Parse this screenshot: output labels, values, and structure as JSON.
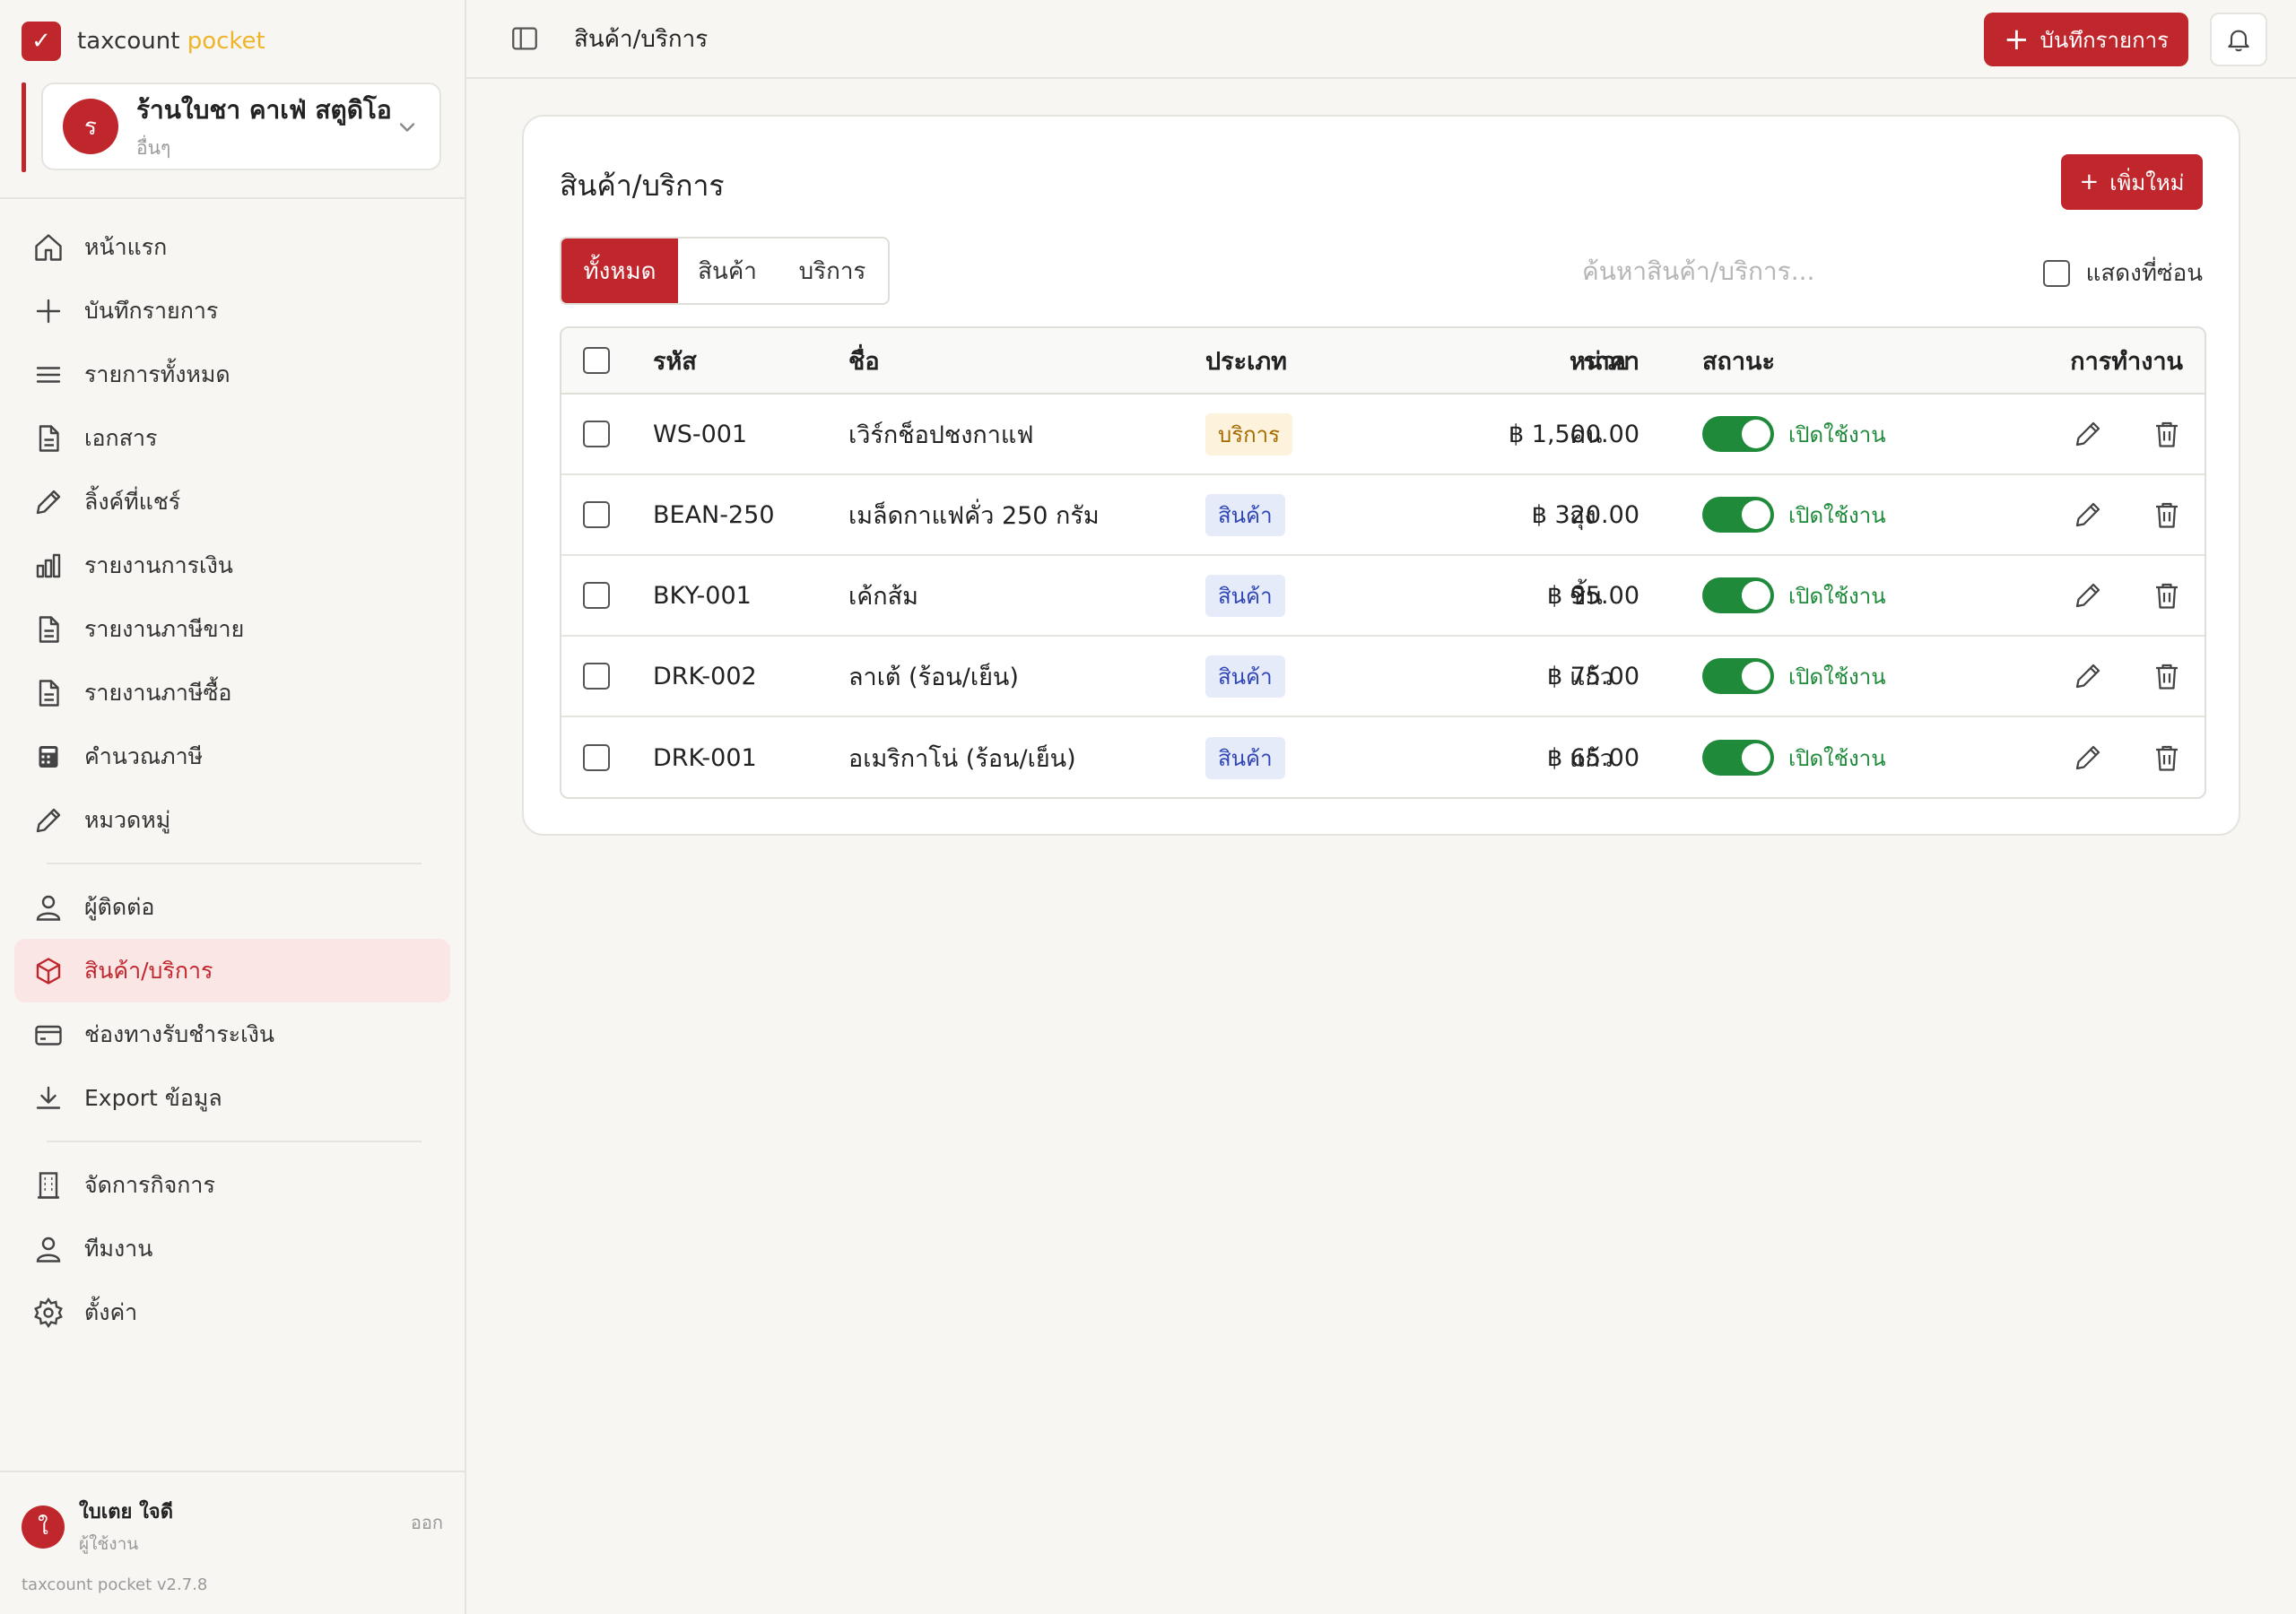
{
  "brand": {
    "name": "taxcount",
    "accent": "pocket",
    "logo_icon": "check-icon"
  },
  "business": {
    "initial": "ร",
    "name": "ร้านใบชา คาเฟ่ สตูดิโอ",
    "type": "อื่นๆ"
  },
  "nav": {
    "items": [
      {
        "label": "หน้าแรก",
        "icon": "home-icon"
      },
      {
        "label": "บันทึกรายการ",
        "icon": "plus-icon"
      },
      {
        "label": "รายการทั้งหมด",
        "icon": "list-icon"
      },
      {
        "label": "เอกสาร",
        "icon": "document-icon"
      },
      {
        "label": "ลิ้งค์ที่แชร์",
        "icon": "pencil-icon"
      },
      {
        "label": "รายงานการเงิน",
        "icon": "bar-chart-icon"
      },
      {
        "label": "รายงานภาษีขาย",
        "icon": "document-icon"
      },
      {
        "label": "รายงานภาษีซื้อ",
        "icon": "document-icon"
      },
      {
        "label": "คำนวณภาษี",
        "icon": "calculator-icon"
      },
      {
        "label": "หมวดหมู่",
        "icon": "pencil-icon"
      }
    ],
    "group2": [
      {
        "label": "ผู้ติดต่อ",
        "icon": "user-icon"
      },
      {
        "label": "สินค้า/บริการ",
        "icon": "box-icon",
        "active": true
      },
      {
        "label": "ช่องทางรับชำระเงิน",
        "icon": "credit-card-icon"
      },
      {
        "label": "Export ข้อมูล",
        "icon": "download-icon"
      }
    ],
    "group3": [
      {
        "label": "จัดการกิจการ",
        "icon": "building-icon"
      },
      {
        "label": "ทีมงาน",
        "icon": "user-icon"
      },
      {
        "label": "ตั้งค่า",
        "icon": "gear-icon"
      }
    ]
  },
  "user": {
    "initial": "ใ",
    "name": "ใบเตย ใจดี",
    "role": "ผู้ใช้งาน",
    "logout": "ออก"
  },
  "version": "taxcount pocket v2.7.8",
  "topbar": {
    "title": "สินค้า/บริการ",
    "record_button": "บันทึกรายการ"
  },
  "card": {
    "title": "สินค้า/บริการ",
    "add_button": "เพิ่มใหม่",
    "tabs": [
      "ทั้งหมด",
      "สินค้า",
      "บริการ"
    ],
    "search_placeholder": "ค้นหาสินค้า/บริการ...",
    "show_hidden": "แสดงที่ซ่อน"
  },
  "table": {
    "headers": {
      "code": "รหัส",
      "name": "ชื่อ",
      "type": "ประเภท",
      "price": "ราคา",
      "unit": "หน่วย",
      "status": "สถานะ",
      "actions": "การทำงาน"
    },
    "rows": [
      {
        "code": "WS-001",
        "name": "เวิร์กช็อปชงกาแฟ",
        "type": "บริการ",
        "kind": "service",
        "price": "฿ 1,500.00",
        "unit": "คน",
        "status": "เปิดใช้งาน"
      },
      {
        "code": "BEAN-250",
        "name": "เมล็ดกาแฟคั่ว 250 กรัม",
        "type": "สินค้า",
        "kind": "product",
        "price": "฿ 320.00",
        "unit": "ถุง",
        "status": "เปิดใช้งาน"
      },
      {
        "code": "BKY-001",
        "name": "เค้กส้ม",
        "type": "สินค้า",
        "kind": "product",
        "price": "฿ 95.00",
        "unit": "ชิ้น",
        "status": "เปิดใช้งาน"
      },
      {
        "code": "DRK-002",
        "name": "ลาเต้ (ร้อน/เย็น)",
        "type": "สินค้า",
        "kind": "product",
        "price": "฿ 75.00",
        "unit": "แก้ว",
        "status": "เปิดใช้งาน"
      },
      {
        "code": "DRK-001",
        "name": "อเมริกาโน่ (ร้อน/เย็น)",
        "type": "สินค้า",
        "kind": "product",
        "price": "฿ 65.00",
        "unit": "แก้ว",
        "status": "เปิดใช้งาน"
      }
    ]
  },
  "colors": {
    "accent": "#c0272d",
    "active_bg": "#fbe6e6",
    "success": "#1e8a3a",
    "brand_accent": "#f0b429"
  }
}
